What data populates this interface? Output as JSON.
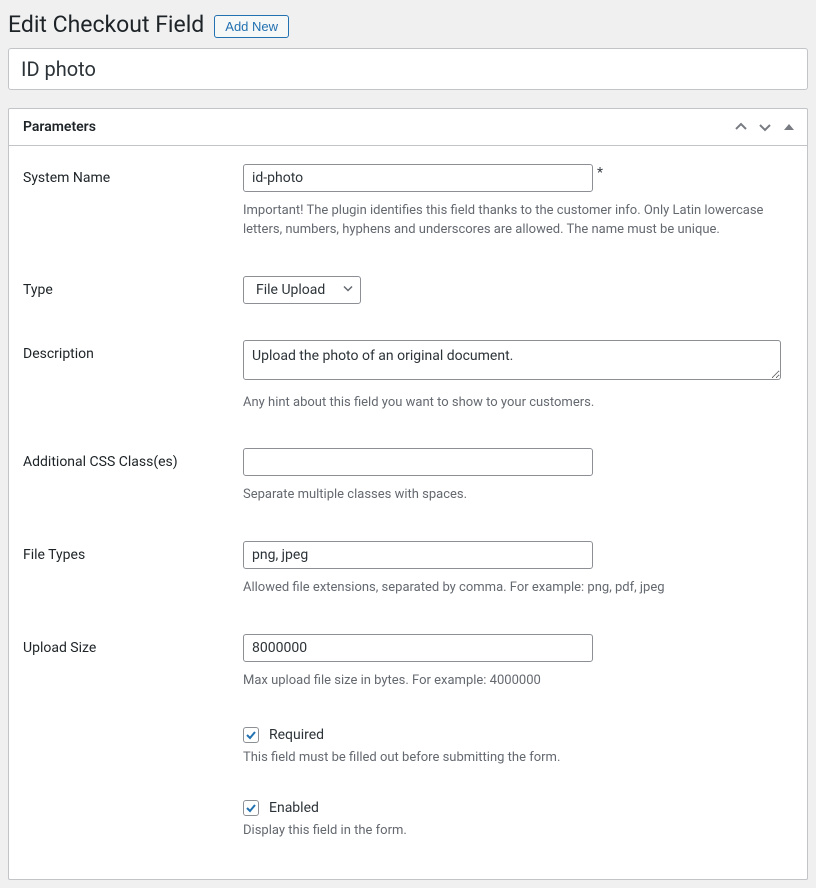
{
  "header": {
    "title": "Edit Checkout Field",
    "add_new_label": "Add New"
  },
  "title_field": {
    "value": "ID photo"
  },
  "panel": {
    "title": "Parameters",
    "fields": {
      "system_name": {
        "label": "System Name",
        "value": "id-photo",
        "required_mark": "*",
        "help": "Important! The plugin identifies this field thanks to the customer info. Only Latin lowercase letters, numbers, hyphens and underscores are allowed. The name must be unique."
      },
      "type": {
        "label": "Type",
        "selected": "File Upload"
      },
      "description": {
        "label": "Description",
        "value": "Upload the photo of an original document.",
        "help": "Any hint about this field you want to show to your customers."
      },
      "css_classes": {
        "label": "Additional CSS Class(es)",
        "value": "",
        "help": "Separate multiple classes with spaces."
      },
      "file_types": {
        "label": "File Types",
        "value": "png, jpeg",
        "help": "Allowed file extensions, separated by comma. For example: png, pdf, jpeg"
      },
      "upload_size": {
        "label": "Upload Size",
        "value": "8000000",
        "help": "Max upload file size in bytes. For example: 4000000"
      },
      "required": {
        "label": "Required",
        "checked": true,
        "help": "This field must be filled out before submitting the form."
      },
      "enabled": {
        "label": "Enabled",
        "checked": true,
        "help": "Display this field in the form."
      }
    }
  }
}
